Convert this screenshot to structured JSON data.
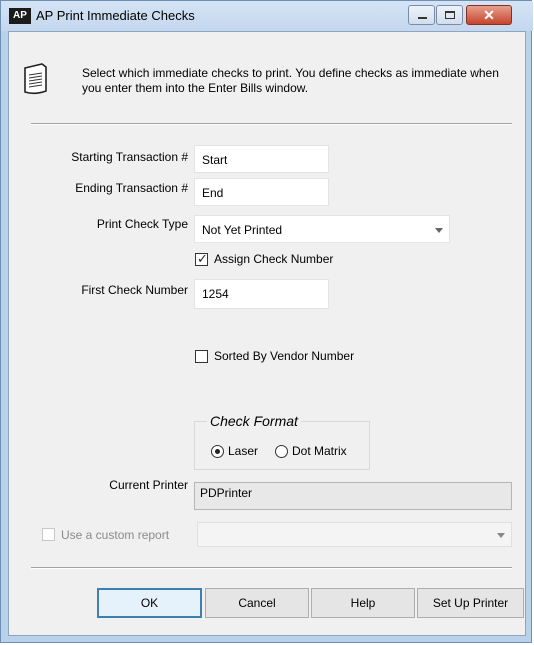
{
  "window": {
    "app_icon_text": "AP",
    "title": "AP Print Immediate Checks"
  },
  "titlebar": {
    "close_glyph": "✕"
  },
  "info": {
    "text": "Select which immediate checks to print. You define checks as immediate when you enter them into the Enter Bills window.",
    "icon": "document-icon"
  },
  "form": {
    "starting_label": "Starting Transaction #",
    "starting_value": "Start",
    "ending_label": "Ending Transaction #",
    "ending_value": "End",
    "check_type_label": "Print Check Type",
    "check_type_value": "Not Yet Printed",
    "assign_label": "Assign Check Number",
    "assign_checked": true,
    "first_check_label": "First Check Number",
    "first_check_value": "1254",
    "sorted_label": "Sorted By Vendor Number",
    "sorted_checked": false
  },
  "check_format": {
    "legend": "Check Format",
    "laser_label": "Laser",
    "dot_matrix_label": "Dot Matrix",
    "selected": "Laser"
  },
  "printer": {
    "label": "Current Printer",
    "value": "PDPrinter"
  },
  "custom_report": {
    "label": "Use a custom report",
    "checked": false,
    "value": ""
  },
  "buttons": {
    "ok": "OK",
    "cancel": "Cancel",
    "help": "Help",
    "setup": "Set Up Printer"
  },
  "colors": {
    "titlebar": "#c3d7ee",
    "client": "#f0f0f0",
    "default_button_border": "#3c7fb1"
  }
}
